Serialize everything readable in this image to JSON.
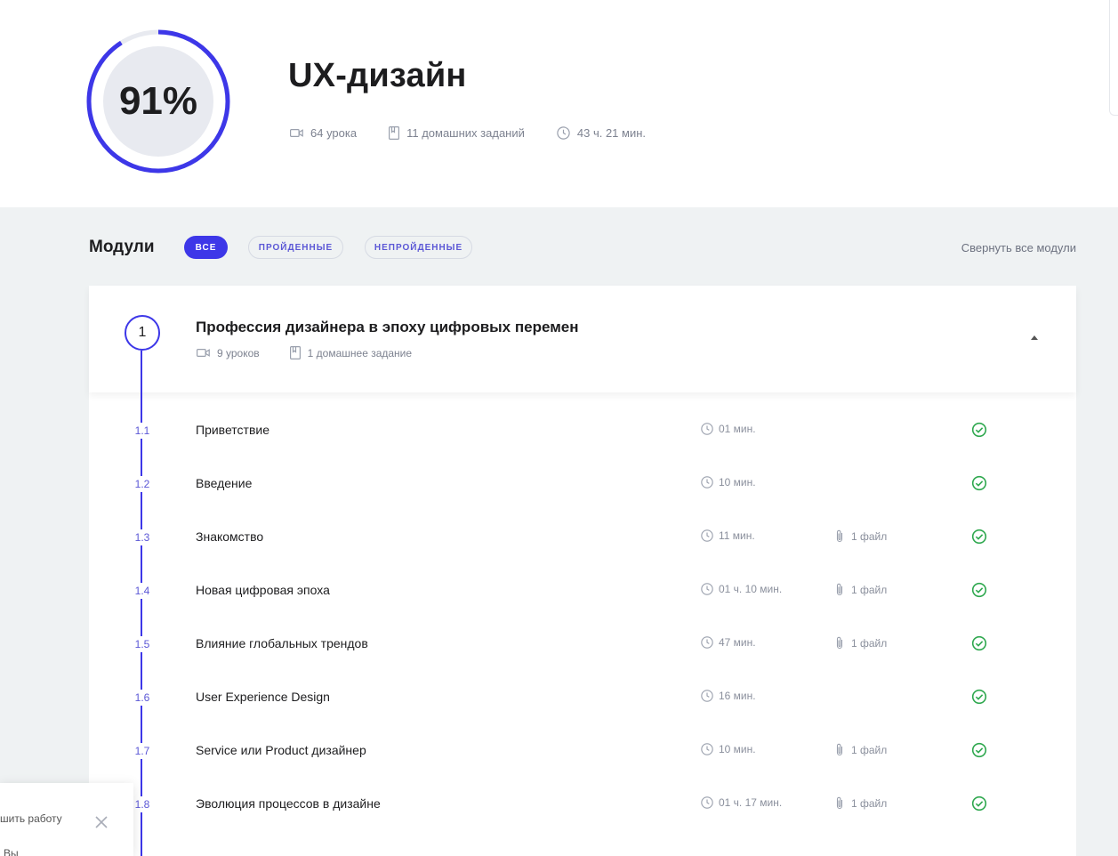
{
  "course": {
    "progress_percent": 91,
    "progress_label": "91%",
    "title": "UX-дизайн",
    "lessons_count": "64 урока",
    "homework_count": "11 домашних заданий",
    "duration": "43 ч. 21 мин."
  },
  "modules": {
    "title": "Модули",
    "filters": [
      "все",
      "пройденные",
      "непройденные"
    ],
    "active_filter": "все",
    "collapse_all": "Свернуть все модули"
  },
  "module1": {
    "number": "1",
    "title": "Профессия дизайнера в эпоху цифровых перемен",
    "lessons": "9 уроков",
    "homework": "1 домашнее задание",
    "expanded": true,
    "items": [
      {
        "num": "1.1",
        "title": "Приветствие",
        "time": "01 мин.",
        "file": "",
        "done": true
      },
      {
        "num": "1.2",
        "title": "Введение",
        "time": "10 мин.",
        "file": "",
        "done": true
      },
      {
        "num": "1.3",
        "title": "Знакомство",
        "time": "11 мин.",
        "file": "1 файл",
        "done": true
      },
      {
        "num": "1.4",
        "title": "Новая цифровая эпоха",
        "time": "01 ч. 10 мин.",
        "file": "1 файл",
        "done": true
      },
      {
        "num": "1.5",
        "title": "Влияние глобальных трендов",
        "time": "47 мин.",
        "file": "1 файл",
        "done": true
      },
      {
        "num": "1.6",
        "title": "User Experience Design",
        "time": "16 мин.",
        "file": "",
        "done": true
      },
      {
        "num": "1.7",
        "title": "Service или Product дизайнер",
        "time": "10 мин.",
        "file": "1 файл",
        "done": true
      },
      {
        "num": "1.8",
        "title": "Эволюция процессов в дизайне",
        "time": "01 ч. 17 мин.",
        "file": "1 файл",
        "done": true
      }
    ]
  },
  "toast": {
    "line1": "шить работу",
    "line2": "Вы"
  },
  "colors": {
    "accent": "#3d37e8",
    "success": "#2fa84f",
    "background": "#eff2f3"
  }
}
